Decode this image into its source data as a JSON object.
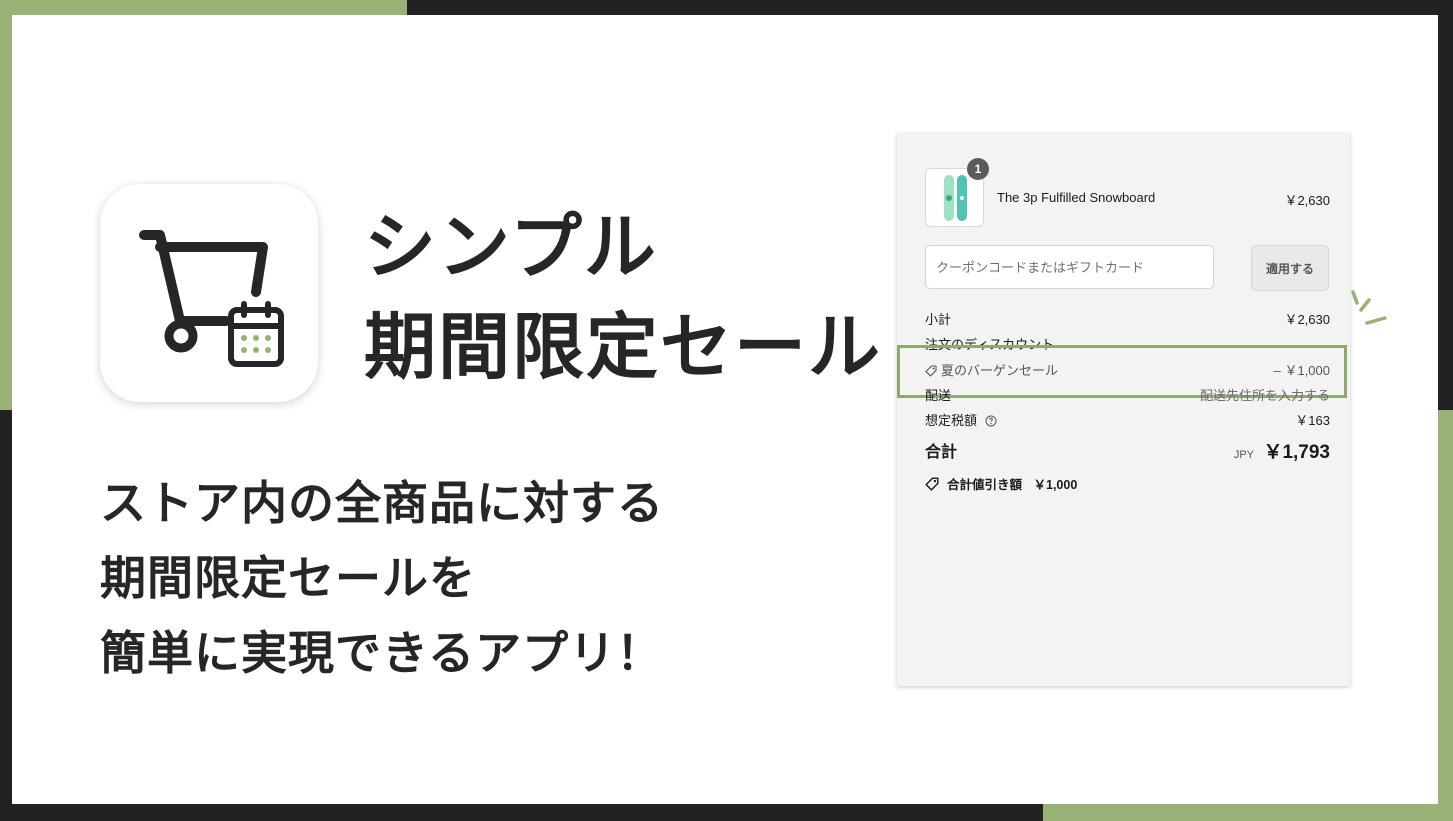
{
  "headline": {
    "line1": "シンプル",
    "line2": "期間限定セール"
  },
  "tagline": {
    "line1": "ストア内の全商品に対する",
    "line2": "期間限定セールを",
    "line3": "簡単に実現できるアプリ！"
  },
  "icons": {
    "app_icon": "shopping-cart-calendar-icon",
    "discount_tag": "tag-icon",
    "help": "question-circle-icon",
    "sparkle": "sparkle-icon"
  },
  "colors": {
    "accent_green": "#97b274",
    "highlight_green": "#8ea86f",
    "dark": "#222222"
  },
  "checkout": {
    "product": {
      "name": "The 3p Fulfilled Snowboard",
      "price": "￥2,630",
      "quantity": "1"
    },
    "coupon": {
      "placeholder": "クーポンコードまたはギフトカード",
      "value": "",
      "apply_label": "適用する"
    },
    "subtotal": {
      "label": "小計",
      "value": "￥2,630"
    },
    "order_discount": {
      "label": "注文のディスカウント"
    },
    "discount_line": {
      "label": "夏のバーゲンセール",
      "value": "– ￥1,000"
    },
    "shipping": {
      "label": "配送",
      "value": "配送先住所を入力する"
    },
    "tax": {
      "label": "想定税額",
      "value": "￥163"
    },
    "total": {
      "label": "合計",
      "currency": "JPY",
      "value": "￥1,793"
    },
    "savings": {
      "label": "合計値引き額",
      "value": "￥1,000"
    }
  }
}
